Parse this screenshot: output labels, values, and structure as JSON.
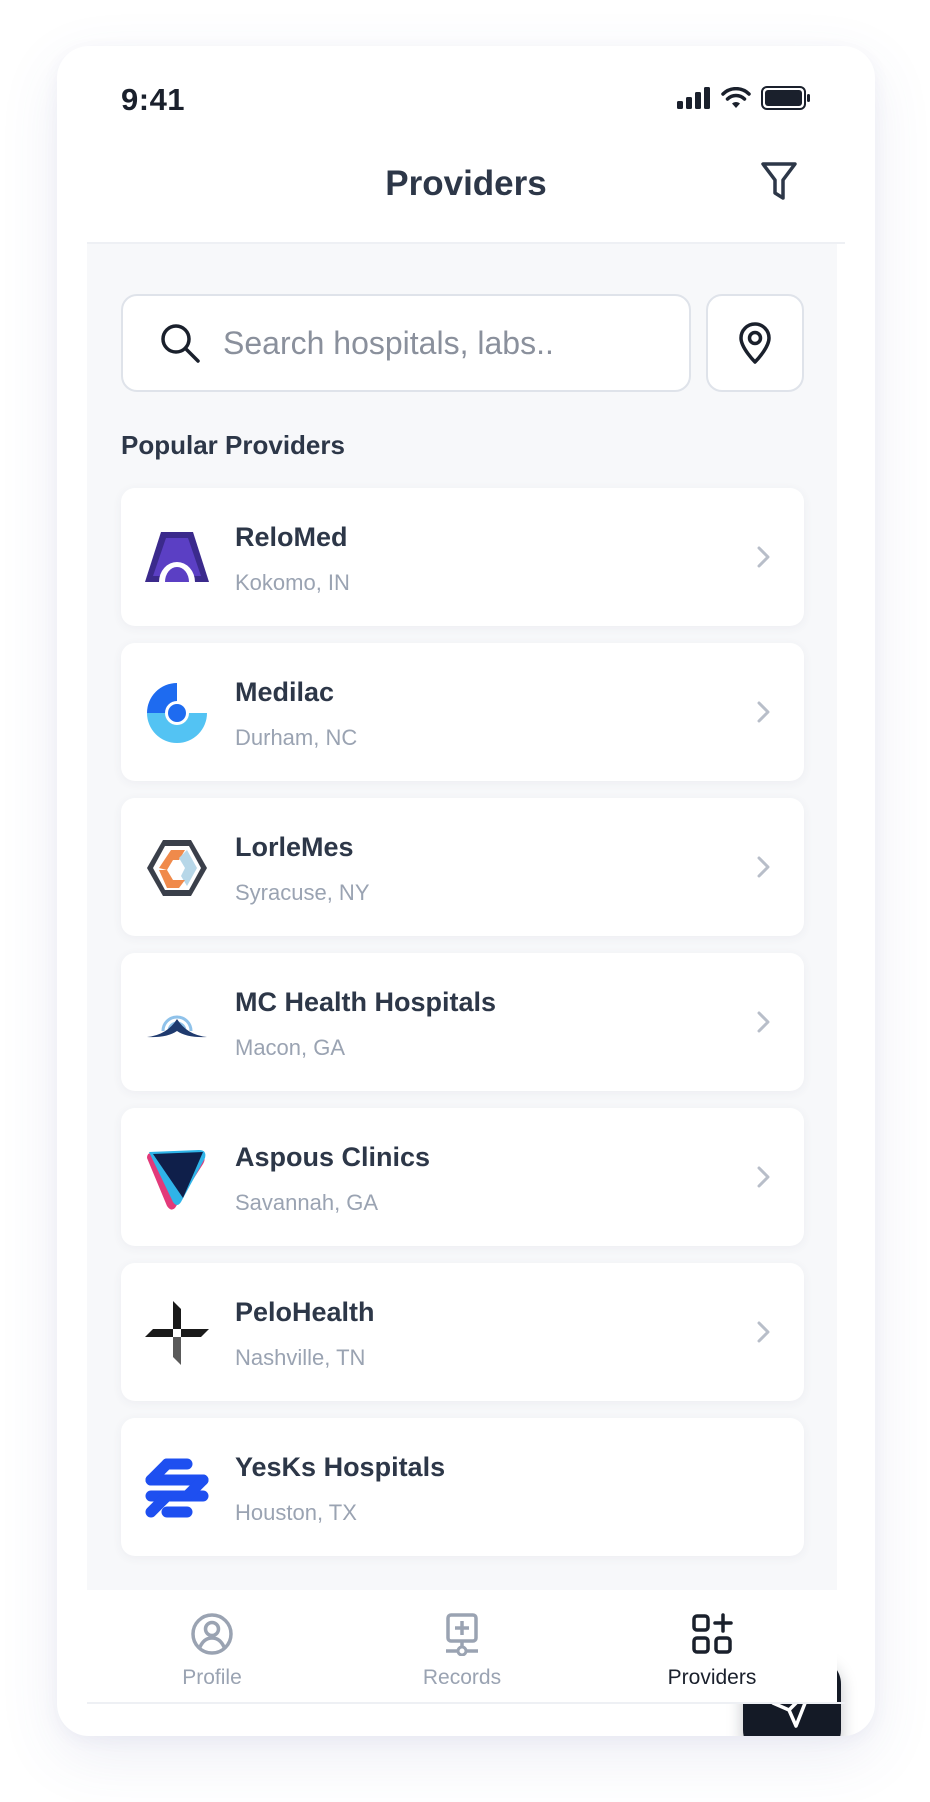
{
  "status_bar": {
    "time": "9:41"
  },
  "header": {
    "title": "Providers"
  },
  "search": {
    "placeholder": "Search hospitals, labs.."
  },
  "section": {
    "title": "Popular Providers"
  },
  "providers": [
    {
      "name": "ReloMed",
      "location": "Kokomo, IN"
    },
    {
      "name": "Medilac",
      "location": "Durham, NC"
    },
    {
      "name": "LorleMes",
      "location": "Syracuse, NY"
    },
    {
      "name": "MC Health Hospitals",
      "location": "Macon, GA"
    },
    {
      "name": "Aspous Clinics",
      "location": "Savannah, GA"
    },
    {
      "name": "PeloHealth",
      "location": "Nashville, TN"
    },
    {
      "name": "YesKs Hospitals",
      "location": "Houston, TX"
    }
  ],
  "bottom_nav": {
    "items": [
      {
        "label": "Profile"
      },
      {
        "label": "Records"
      },
      {
        "label": "Providers"
      }
    ],
    "active": "Providers"
  },
  "colors": {
    "text_primary": "#2d3748",
    "text_secondary": "#9aa3b2",
    "fab": "#141a26",
    "background_content": "#f7f8fa"
  }
}
